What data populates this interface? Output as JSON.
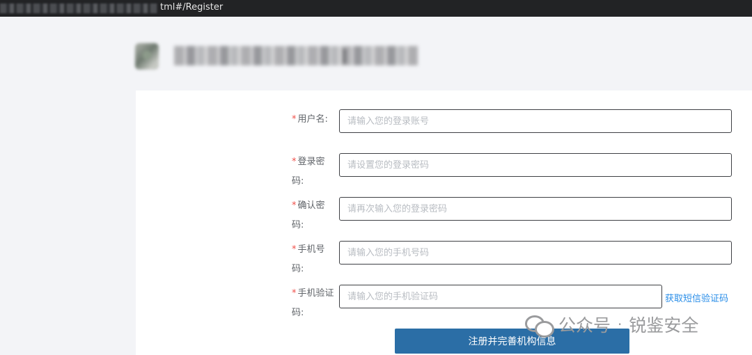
{
  "browser": {
    "url_suffix": "tml#/Register"
  },
  "form": {
    "username": {
      "label": "用户名:",
      "placeholder": "请输入您的登录账号"
    },
    "password": {
      "label": "登录密码:",
      "placeholder": "请设置您的登录密码"
    },
    "confirm_password": {
      "label": "确认密码:",
      "placeholder": "请再次输入您的登录密码"
    },
    "phone": {
      "label": "手机号码:",
      "placeholder": "请输入您的手机号码"
    },
    "sms_code": {
      "label": "手机验证码:",
      "placeholder": "请输入您的手机验证码"
    },
    "required_mark": "*",
    "sms_link": "获取短信验证码",
    "submit_label": "注册并完善机构信息"
  },
  "watermark": {
    "left": "公众号",
    "dot": "·",
    "right": "锐鉴安全"
  },
  "colors": {
    "primary_button": "#2b6ea6",
    "link": "#2a8ee8",
    "required": "#f0504a"
  }
}
